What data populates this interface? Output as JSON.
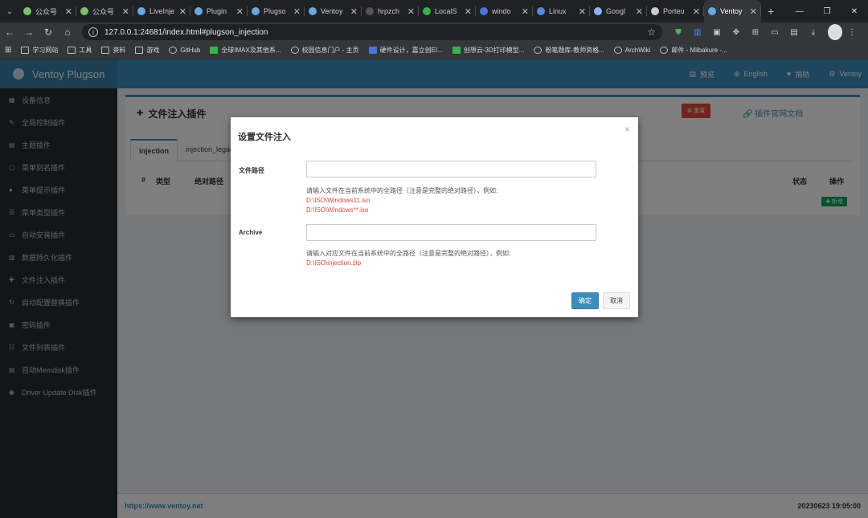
{
  "browser": {
    "tabs": [
      {
        "label": "公众号",
        "color": "#7bc26e",
        "active": false
      },
      {
        "label": "公众号",
        "color": "#7bc26e",
        "active": false
      },
      {
        "label": "LiveInje",
        "color": "#6aa8e0",
        "active": false
      },
      {
        "label": "Plugin",
        "color": "#6aa8e0",
        "active": false
      },
      {
        "label": "Plugso",
        "color": "#6aa8e0",
        "active": false
      },
      {
        "label": "Ventoy",
        "color": "#6aa8e0",
        "active": false
      },
      {
        "label": "hrpzch",
        "color": "#555555",
        "active": false
      },
      {
        "label": "LocalS",
        "color": "#3cb04a",
        "active": false
      },
      {
        "label": "windo",
        "color": "#4a74d8",
        "active": false
      },
      {
        "label": "Linux",
        "color": "#5a8ad8",
        "active": false
      },
      {
        "label": "Googl",
        "color": "#8ab4f8",
        "active": false
      },
      {
        "label": "Porteu",
        "color": "#cccccc",
        "active": false
      },
      {
        "label": "Ventoy",
        "color": "#6aa8e0",
        "active": true
      }
    ],
    "new_tab": "+",
    "url": "127.0.0.1:24681/index.html#plugson_injection",
    "bookmarks": [
      {
        "label": "学习网站",
        "style": "folder"
      },
      {
        "label": "工具",
        "style": "folder"
      },
      {
        "label": "资料",
        "style": "folder"
      },
      {
        "label": "游戏",
        "style": "folder"
      },
      {
        "label": "GitHub",
        "style": "round"
      },
      {
        "label": "全球IMAX及其他系...",
        "style": "green"
      },
      {
        "label": "校园信息门户 - 主页",
        "style": "round"
      },
      {
        "label": "硬件设计，嘉立创EI...",
        "style": "blue"
      },
      {
        "label": "创想云-3D打印模型...",
        "style": "green"
      },
      {
        "label": "粉笔题库-教师资格...",
        "style": "round"
      },
      {
        "label": "ArchWiki",
        "style": "round"
      },
      {
        "label": "邮件 - Milbakure -...",
        "style": "round"
      }
    ]
  },
  "app": {
    "brand": "Ventoy Plugson",
    "header_items": [
      {
        "icon": "▤",
        "label": "预览"
      },
      {
        "icon": "⊕",
        "label": "English"
      },
      {
        "icon": "♥",
        "label": "捐助"
      },
      {
        "icon": "⚙",
        "label": "Ventoy"
      }
    ],
    "sidebar": [
      {
        "icon": "▦",
        "label": "设备信息"
      },
      {
        "icon": "✎",
        "label": "全局控制插件"
      },
      {
        "icon": "▤",
        "label": "主题插件"
      },
      {
        "icon": "▢",
        "label": "菜单别名插件"
      },
      {
        "icon": "●",
        "label": "菜单提示插件"
      },
      {
        "icon": "☰",
        "label": "菜单类型插件"
      },
      {
        "icon": "▭",
        "label": "自动安装插件"
      },
      {
        "icon": "▥",
        "label": "数据持久化插件"
      },
      {
        "icon": "✚",
        "label": "文件注入插件"
      },
      {
        "icon": "↻",
        "label": "启动配置替换插件"
      },
      {
        "icon": "▣",
        "label": "密码插件"
      },
      {
        "icon": "☷",
        "label": "文件列表插件"
      },
      {
        "icon": "▤",
        "label": "自动Memdisk插件"
      },
      {
        "icon": "◉",
        "label": "Driver Update Disk插件"
      }
    ],
    "panel": {
      "title": "文件注入插件",
      "title_icon": "✚",
      "reset_label": "♻ 重置",
      "doc_link": "🔗 插件官网文档",
      "tabs": [
        "injection",
        "injection_legacy"
      ],
      "columns": {
        "num": "#",
        "type": "类型",
        "path": "绝对路径",
        "status": "状态",
        "action": "操作"
      },
      "add_label": "✚ 新增"
    },
    "footer": {
      "link": "https://www.ventoy.net",
      "timestamp": "20230623 19:05:00"
    }
  },
  "modal": {
    "title": "设置文件注入",
    "close": "×",
    "path_label": "文件路径",
    "path_value": "",
    "path_help": "请输入文件在当前系统中的全路径（注意是完整的绝对路径），例如:",
    "path_ex1": "D:\\ISO\\Windows11.iso",
    "path_ex2": "D:\\ISO\\Windows**.iso",
    "archive_label": "Archive",
    "archive_value": "",
    "archive_help": "请输入对应文件在当前系统中的全路径（注意是完整的绝对路径），例如:",
    "archive_ex": "D:\\ISO\\injection.zip",
    "ok_label": "确定",
    "cancel_label": "取消"
  }
}
